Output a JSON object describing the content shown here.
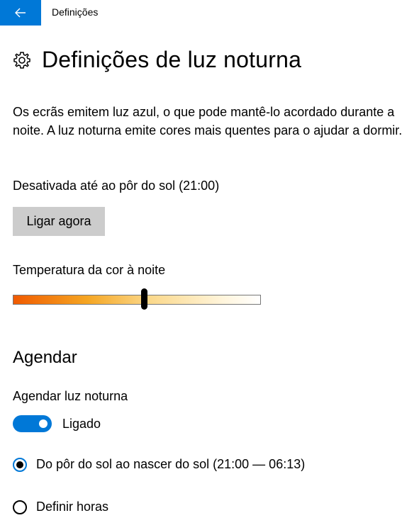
{
  "titlebar": {
    "title": "Definições"
  },
  "header": {
    "icon": "gear-icon",
    "title": "Definições de luz noturna"
  },
  "description": "Os ecrãs emitem luz azul, o que pode mantê-lo acordado durante a noite. A luz noturna emite cores mais quentes para o ajudar a dormir.",
  "status": "Desativada até ao pôr do sol (21:00)",
  "turn_on_button": "Ligar agora",
  "temperature": {
    "label": "Temperatura da cor à noite",
    "value_fraction": 0.53
  },
  "schedule": {
    "heading": "Agendar",
    "label": "Agendar luz noturna",
    "toggle_state": "Ligado",
    "toggle_on": true,
    "options": [
      {
        "label": "Do pôr do sol ao nascer do sol (21:00 — 06:13)",
        "selected": true
      },
      {
        "label": "Definir horas",
        "selected": false
      }
    ]
  },
  "colors": {
    "accent": "#0078d7",
    "button_bg": "#cccccc"
  }
}
